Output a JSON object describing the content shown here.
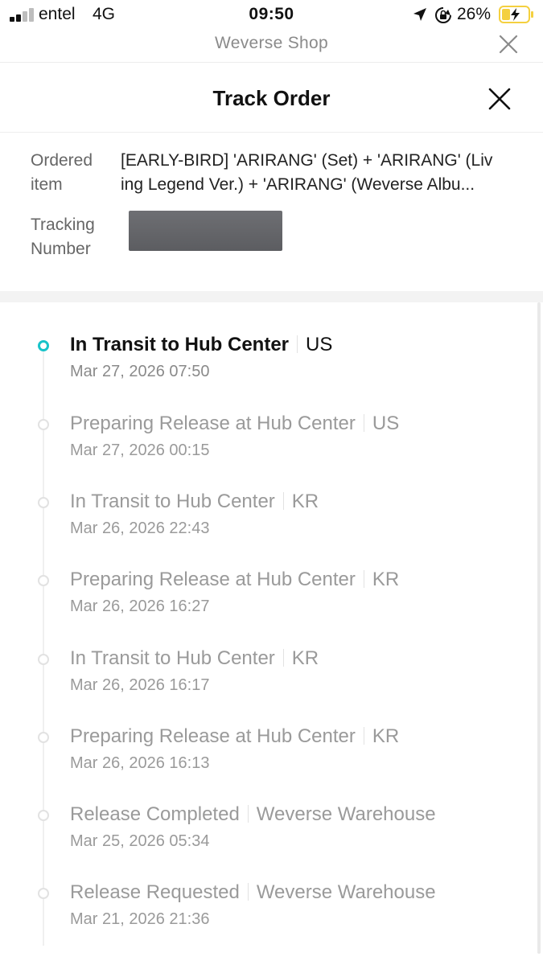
{
  "status_bar": {
    "carrier": "entel",
    "network": "4G",
    "time": "09:50",
    "battery": "26%",
    "icons": [
      "signal-bars-icon",
      "location-arrow-icon",
      "rotation-lock-icon",
      "battery-charging-icon"
    ]
  },
  "webview": {
    "title": "Weverse Shop",
    "close_icon": "close-icon"
  },
  "modal": {
    "title": "Track Order",
    "close_icon": "close-icon"
  },
  "order": {
    "item_label": "Ordered item",
    "item_lines": [
      "[EARLY-BIRD] 'ARIRANG' (Set) + 'ARIRANG' (Liv",
      "ing Legend Ver.) + 'ARIRANG' (Weverse Albu..."
    ],
    "tracking_label": "Tracking Number"
  },
  "timeline": [
    {
      "status": "In Transit to Hub Center",
      "location": "US",
      "date": "Mar 27, 2026 07:50",
      "active": true
    },
    {
      "status": "Preparing Release at Hub Center",
      "location": "US",
      "date": "Mar 27, 2026 00:15",
      "active": false
    },
    {
      "status": "In Transit to Hub Center",
      "location": "KR",
      "date": "Mar 26, 2026 22:43",
      "active": false
    },
    {
      "status": "Preparing Release at Hub Center",
      "location": "KR",
      "date": "Mar 26, 2026 16:27",
      "active": false
    },
    {
      "status": "In Transit to Hub Center",
      "location": "KR",
      "date": "Mar 26, 2026 16:17",
      "active": false
    },
    {
      "status": "Preparing Release at Hub Center",
      "location": "KR",
      "date": "Mar 26, 2026 16:13",
      "active": false
    },
    {
      "status": "Release Completed",
      "location": "Weverse Warehouse",
      "date": "Mar 25, 2026 05:34",
      "active": false
    },
    {
      "status": "Release Requested",
      "location": "Weverse Warehouse",
      "date": "Mar 21, 2026 21:36",
      "active": false
    }
  ],
  "colors": {
    "accent": "#18c3c9",
    "battery_fill": "#f4d03f",
    "muted_text": "#9a9a9a"
  }
}
